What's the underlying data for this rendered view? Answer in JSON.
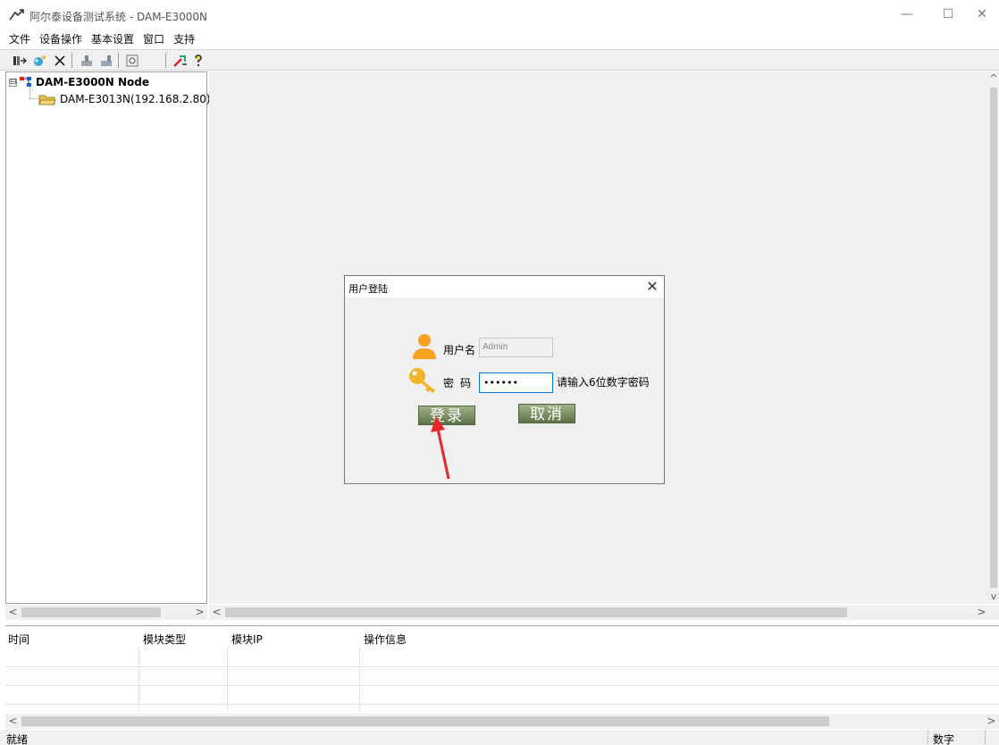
{
  "window": {
    "title": "阿尔泰设备测试系统 - DAM-E3000N",
    "minimize_glyph": "—",
    "maximize_glyph": "☐",
    "close_glyph": "✕"
  },
  "menu": {
    "items": [
      "文件",
      "设备操作",
      "基本设置",
      "窗口",
      "支持"
    ]
  },
  "toolbar": {
    "icons": [
      "connect-icon",
      "search-device-icon",
      "disconnect-icon",
      "upload-icon",
      "download-icon",
      "refresh-icon",
      "tools-icon",
      "help-icon"
    ]
  },
  "tree": {
    "root_label": "DAM-E3000N Node",
    "child_label": "DAM-E3013N(192.168.2.80)",
    "expander": "⊟"
  },
  "dialog": {
    "title": "用户登陆",
    "close_glyph": "✕",
    "username_label": "用户名",
    "username_value": "Admin",
    "password_label": "密码",
    "password_value": "••••••",
    "hint": "请输入6位数字密码",
    "login_label": "登录",
    "cancel_label": "取消"
  },
  "log": {
    "columns": [
      "时间",
      "模块类型",
      "模块IP",
      "操作信息"
    ]
  },
  "status": {
    "text": "就绪",
    "numlock": "数字"
  },
  "scroll": {
    "left": "<",
    "right": ">",
    "up": "^",
    "down": "v"
  },
  "colors": {
    "button_top": "#a3b187",
    "button_bottom": "#5b7247",
    "annotation_arrow": "#e8262a",
    "focus_border": "#0078d7"
  }
}
